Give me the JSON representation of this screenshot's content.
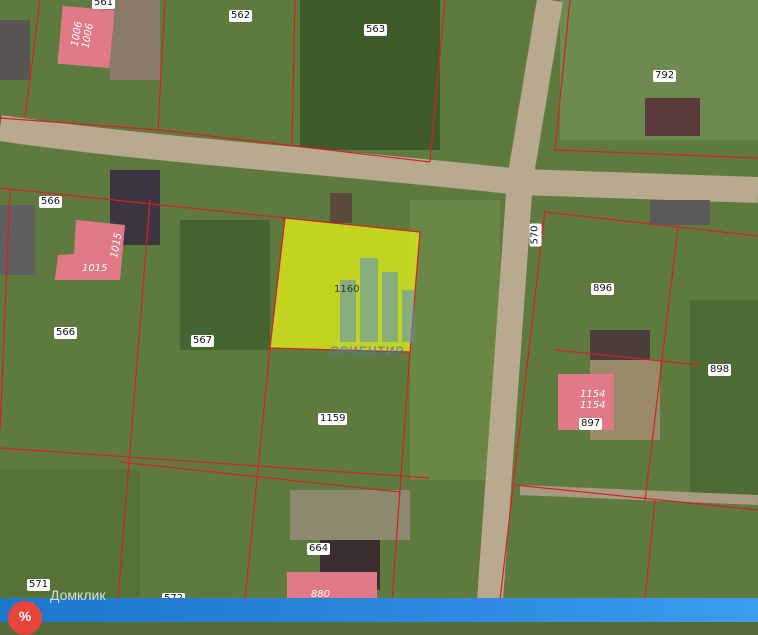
{
  "map": {
    "colors": {
      "boundary": "#d81f26",
      "selected_fill": "#d8e81a",
      "building_fill": "#e07a86",
      "road": "#b9a98e"
    },
    "selected_parcel": {
      "number": "1160"
    },
    "parcel_labels": [
      {
        "id": "561",
        "text": "561"
      },
      {
        "id": "562",
        "text": "562"
      },
      {
        "id": "563",
        "text": "563"
      },
      {
        "id": "792",
        "text": "792"
      },
      {
        "id": "566a",
        "text": "566"
      },
      {
        "id": "566b",
        "text": "566"
      },
      {
        "id": "570",
        "text": "570"
      },
      {
        "id": "567",
        "text": "567"
      },
      {
        "id": "896",
        "text": "896"
      },
      {
        "id": "898",
        "text": "898"
      },
      {
        "id": "897",
        "text": "897"
      },
      {
        "id": "1159",
        "text": "1159"
      },
      {
        "id": "664",
        "text": "664"
      },
      {
        "id": "571",
        "text": "571"
      },
      {
        "id": "572",
        "text": "572"
      }
    ],
    "building_labels": [
      {
        "id": "b1006",
        "lines": [
          "1006",
          "1006"
        ]
      },
      {
        "id": "b1015a",
        "lines": [
          "1015"
        ]
      },
      {
        "id": "b1015b",
        "lines": [
          "1015"
        ]
      },
      {
        "id": "b1154",
        "lines": [
          "1154",
          "1154"
        ]
      },
      {
        "id": "b880",
        "lines": [
          "880"
        ]
      }
    ],
    "watermark_text": "ОРИЕНТИР",
    "footer": {
      "brand": "Домклик",
      "logo_icon": "domclick-logo-icon"
    }
  }
}
